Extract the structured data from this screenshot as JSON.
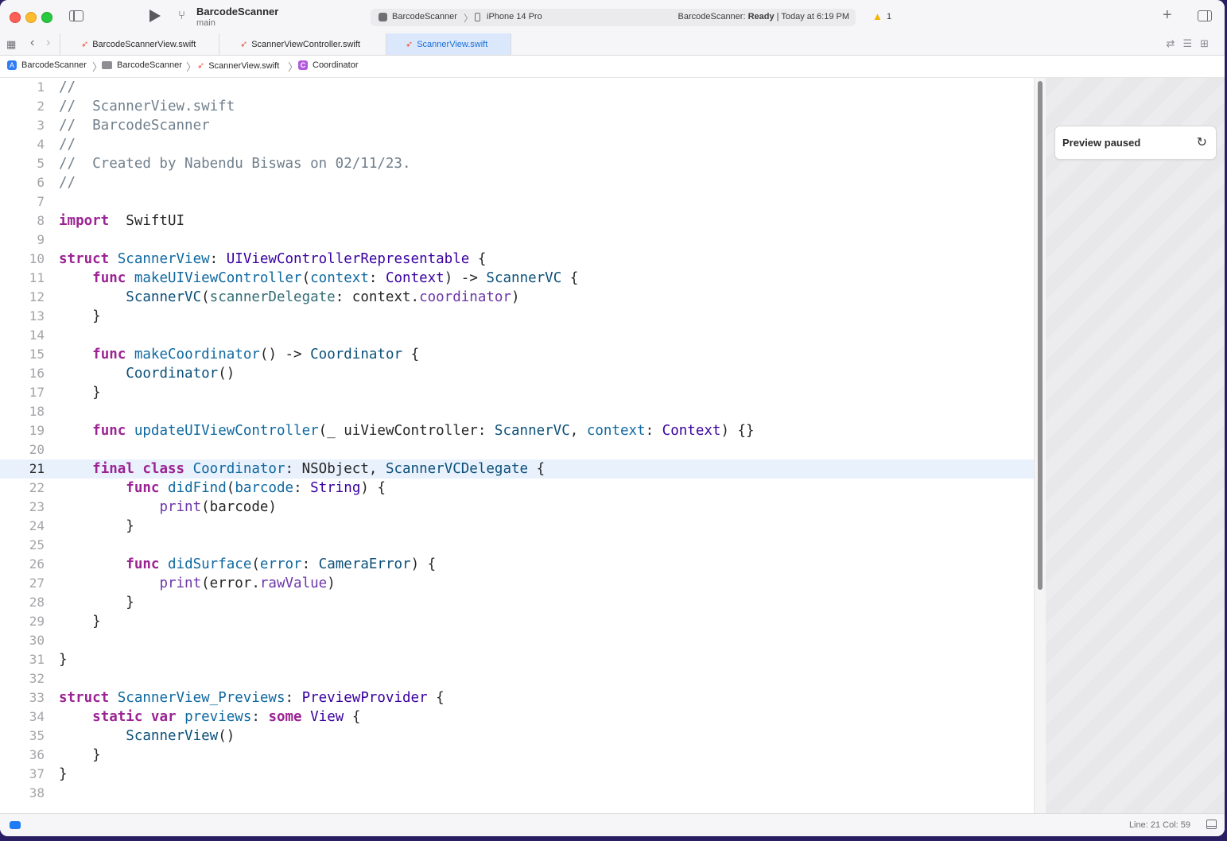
{
  "toolbar": {
    "project_name": "BarcodeScanner",
    "branch": "main",
    "scheme": "BarcodeScanner",
    "device": "iPhone 14 Pro",
    "status_prefix": "BarcodeScanner:",
    "status_state": "Ready",
    "status_time": "| Today at 6:19 PM",
    "warning_count": "1"
  },
  "tabs": [
    {
      "label": "BarcodeScannerView.swift",
      "active": false
    },
    {
      "label": "ScannerViewController.swift",
      "active": false
    },
    {
      "label": "ScannerView.swift",
      "active": true
    }
  ],
  "breadcrumb": [
    "BarcodeScanner",
    "BarcodeScanner",
    "ScannerView.swift",
    "Coordinator"
  ],
  "editor": {
    "current_line": 21,
    "lines": [
      [
        [
          "c-com",
          "//"
        ]
      ],
      [
        [
          "c-com",
          "//  ScannerView.swift"
        ]
      ],
      [
        [
          "c-com",
          "//  BarcodeScanner"
        ]
      ],
      [
        [
          "c-com",
          "//"
        ]
      ],
      [
        [
          "c-com",
          "//  Created by Nabendu Biswas on 02/11/23."
        ]
      ],
      [
        [
          "c-com",
          "//"
        ]
      ],
      [],
      [
        [
          "c-kw",
          "import"
        ],
        [
          "",
          "  SwiftUI"
        ]
      ],
      [],
      [
        [
          "c-kw",
          "struct"
        ],
        [
          "",
          " "
        ],
        [
          "c-decl",
          "ScannerView"
        ],
        [
          "",
          ": "
        ],
        [
          "c-type",
          "UIViewControllerRepresentable"
        ],
        [
          "",
          " {"
        ]
      ],
      [
        [
          "",
          "    "
        ],
        [
          "c-kw",
          "func"
        ],
        [
          "",
          " "
        ],
        [
          "c-decl",
          "makeUIViewController"
        ],
        [
          "",
          "("
        ],
        [
          "c-decl",
          "context"
        ],
        [
          "",
          ": "
        ],
        [
          "c-type",
          "Context"
        ],
        [
          "",
          ") -> "
        ],
        [
          "c-ptype",
          "ScannerVC"
        ],
        [
          "",
          " {"
        ]
      ],
      [
        [
          "",
          "        "
        ],
        [
          "c-ptype",
          "ScannerVC"
        ],
        [
          "",
          "("
        ],
        [
          "c-param",
          "scannerDelegate"
        ],
        [
          "",
          ": context."
        ],
        [
          "c-prop",
          "coordinator"
        ],
        [
          "",
          ")"
        ]
      ],
      [
        [
          "",
          "    }"
        ]
      ],
      [],
      [
        [
          "",
          "    "
        ],
        [
          "c-kw",
          "func"
        ],
        [
          "",
          " "
        ],
        [
          "c-decl",
          "makeCoordinator"
        ],
        [
          "",
          "() -> "
        ],
        [
          "c-ptype",
          "Coordinator"
        ],
        [
          "",
          " {"
        ]
      ],
      [
        [
          "",
          "        "
        ],
        [
          "c-ptype",
          "Coordinator"
        ],
        [
          "",
          "()"
        ]
      ],
      [
        [
          "",
          "    }"
        ]
      ],
      [],
      [
        [
          "",
          "    "
        ],
        [
          "c-kw",
          "func"
        ],
        [
          "",
          " "
        ],
        [
          "c-decl",
          "updateUIViewController"
        ],
        [
          "",
          "(_ uiViewController: "
        ],
        [
          "c-ptype",
          "ScannerVC"
        ],
        [
          "",
          ", "
        ],
        [
          "c-decl",
          "context"
        ],
        [
          "",
          ": "
        ],
        [
          "c-type",
          "Context"
        ],
        [
          "",
          ") {}"
        ]
      ],
      [],
      [
        [
          "",
          "    "
        ],
        [
          "c-kw",
          "final class"
        ],
        [
          "",
          " "
        ],
        [
          "c-decl",
          "Coordinator"
        ],
        [
          "",
          ": NSObject, "
        ],
        [
          "c-ptype",
          "ScannerVCDelegate"
        ],
        [
          "",
          " {"
        ]
      ],
      [
        [
          "",
          "        "
        ],
        [
          "c-kw",
          "func"
        ],
        [
          "",
          " "
        ],
        [
          "c-decl",
          "didFind"
        ],
        [
          "",
          "("
        ],
        [
          "c-decl",
          "barcode"
        ],
        [
          "",
          ": "
        ],
        [
          "c-type",
          "String"
        ],
        [
          "",
          ") {"
        ]
      ],
      [
        [
          "",
          "            "
        ],
        [
          "c-sys",
          "print"
        ],
        [
          "",
          "(barcode)"
        ]
      ],
      [
        [
          "",
          "        }"
        ]
      ],
      [],
      [
        [
          "",
          "        "
        ],
        [
          "c-kw",
          "func"
        ],
        [
          "",
          " "
        ],
        [
          "c-decl",
          "didSurface"
        ],
        [
          "",
          "("
        ],
        [
          "c-decl",
          "error"
        ],
        [
          "",
          ": "
        ],
        [
          "c-ptype",
          "CameraError"
        ],
        [
          "",
          ") {"
        ]
      ],
      [
        [
          "",
          "            "
        ],
        [
          "c-sys",
          "print"
        ],
        [
          "",
          "(error."
        ],
        [
          "c-prop",
          "rawValue"
        ],
        [
          "",
          ")"
        ]
      ],
      [
        [
          "",
          "        }"
        ]
      ],
      [
        [
          "",
          "    }"
        ]
      ],
      [],
      [
        [
          "",
          "}"
        ]
      ],
      [],
      [
        [
          "c-kw",
          "struct"
        ],
        [
          "",
          " "
        ],
        [
          "c-decl",
          "ScannerView_Previews"
        ],
        [
          "",
          ": "
        ],
        [
          "c-type",
          "PreviewProvider"
        ],
        [
          "",
          " {"
        ]
      ],
      [
        [
          "",
          "    "
        ],
        [
          "c-kw",
          "static var"
        ],
        [
          "",
          " "
        ],
        [
          "c-decl",
          "previews"
        ],
        [
          "",
          ": "
        ],
        [
          "c-kw",
          "some"
        ],
        [
          "",
          " "
        ],
        [
          "c-type",
          "View"
        ],
        [
          "",
          " {"
        ]
      ],
      [
        [
          "",
          "        "
        ],
        [
          "c-ptype",
          "ScannerView"
        ],
        [
          "",
          "()"
        ]
      ],
      [
        [
          "",
          "    }"
        ]
      ],
      [
        [
          "",
          "}"
        ]
      ],
      []
    ]
  },
  "preview": {
    "status": "Preview paused"
  },
  "statusbar": {
    "cursor": "Line: 21  Col: 59"
  }
}
